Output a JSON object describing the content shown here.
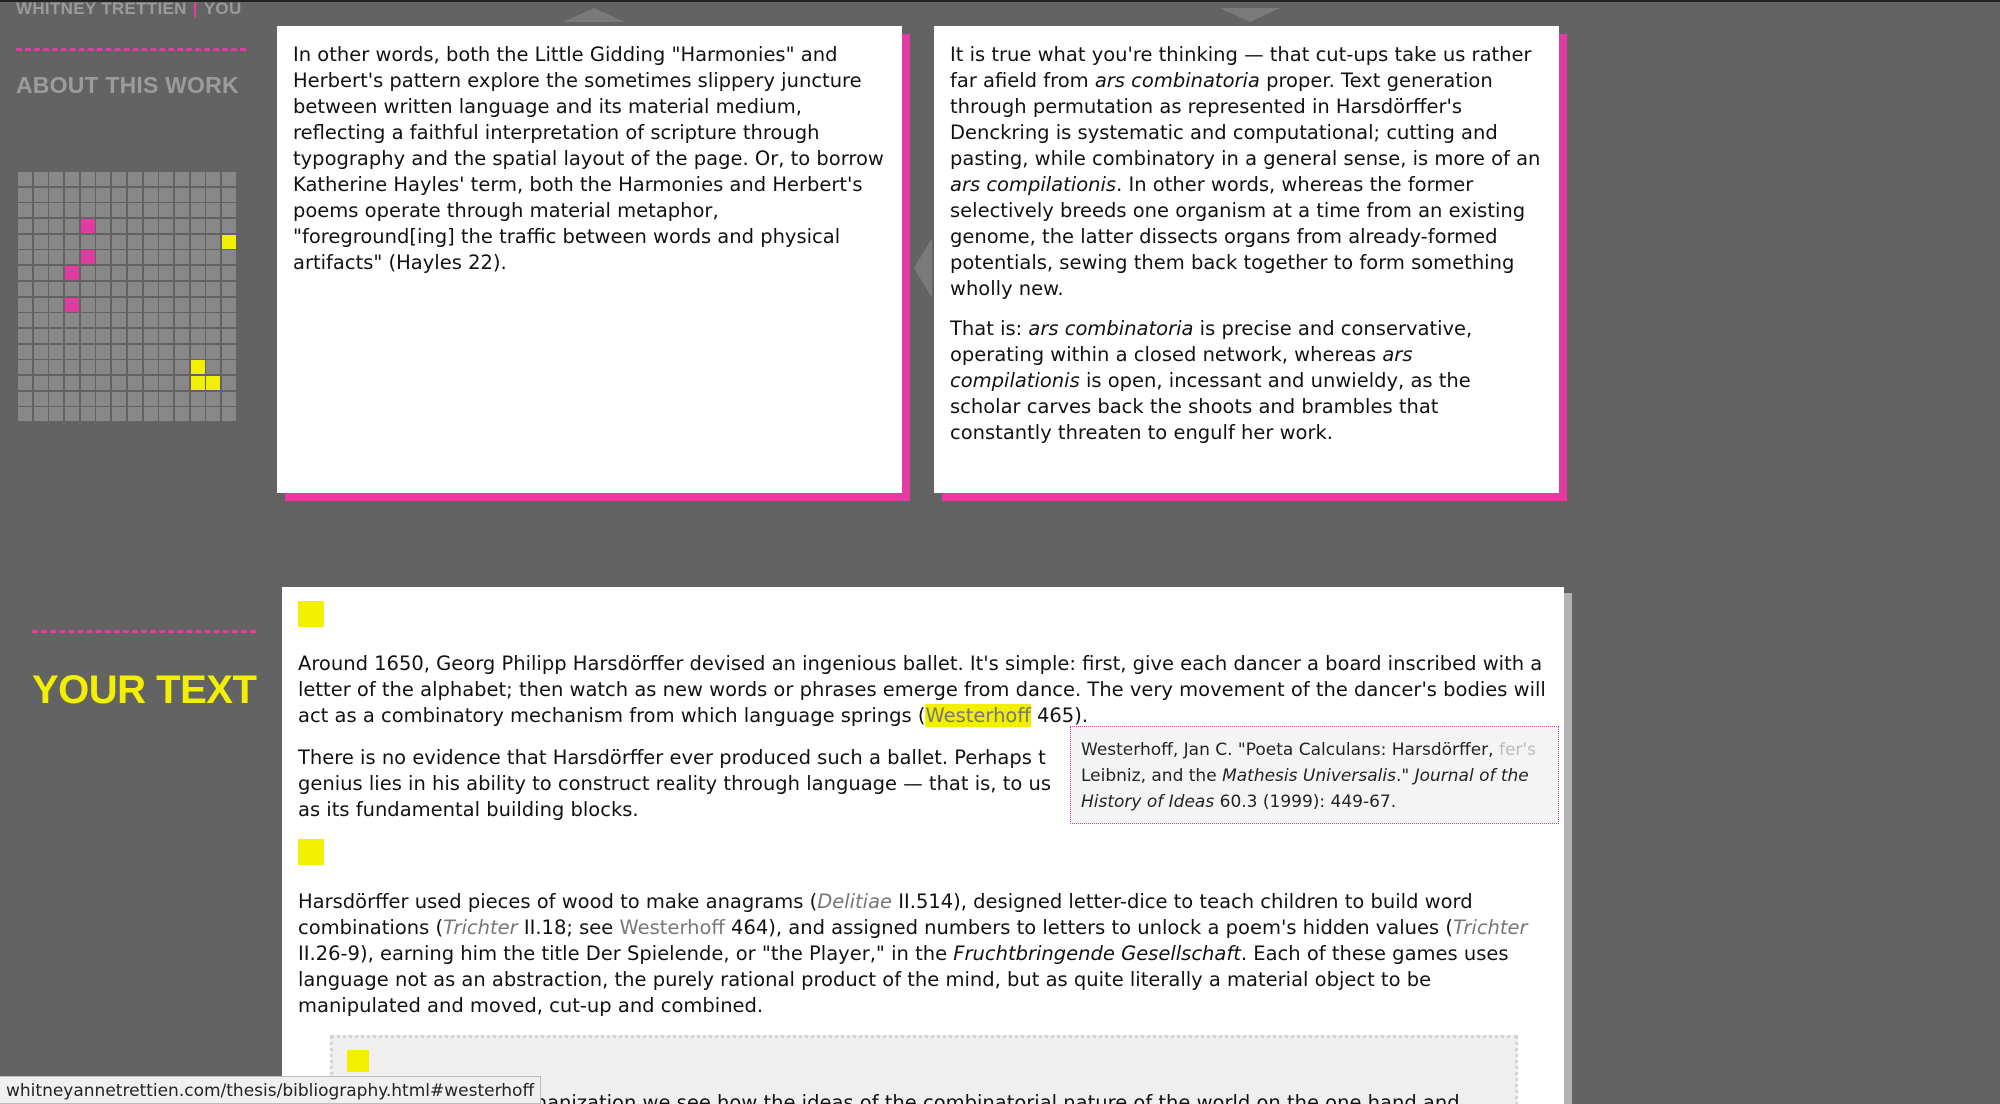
{
  "site_nav": {
    "author": "WHITNEY TRETTIEN",
    "separator": "|",
    "you": "YOU"
  },
  "about": {
    "heading": "ABOUT THIS WORK"
  },
  "grid": {
    "columns": 14,
    "rows": 16,
    "pink_cells": [
      [
        3,
        6
      ],
      [
        3,
        8
      ],
      [
        4,
        3
      ],
      [
        4,
        5
      ]
    ],
    "yellow_cells": [
      [
        11,
        12
      ],
      [
        11,
        13
      ],
      [
        12,
        13
      ],
      [
        13,
        4
      ]
    ]
  },
  "panel_left": {
    "text": "In other words, both the Little Gidding \"Harmonies\" and Herbert's pattern explore the sometimes slippery juncture between written language and its material medium, reflecting a faithful interpretation of scripture through typography and the spatial layout of the page. Or, to borrow Katherine Hayles' term, both the Harmonies and Herbert's poems operate through material metaphor, \"foreground[ing] the traffic between words and physical artifacts\" (Hayles 22)."
  },
  "panel_right": {
    "p1_a": "It is true what you're thinking — that cut-ups take us rather far afield from ",
    "p1_b": "ars combinatoria",
    "p1_c": " proper. Text generation through permutation as represented in Harsdörffer's Denckring is systematic and computational; cutting and pasting, while combinatory in a general sense, is more of an ",
    "p1_d": "ars compilationis",
    "p1_e": ". In other words, whereas the former selectively breeds one organism at a time from an existing genome, the latter dissects organs from already-formed potentials, sewing them back together to form something wholly new.",
    "p2_a": "That is: ",
    "p2_b": "ars combinatoria",
    "p2_c": " is precise and conservative, operating within a closed network, whereas ",
    "p2_d": "ars compilationis",
    "p2_e": " is open, incessant and unwieldy, as the scholar carves back the shoots and brambles that constantly threaten to engulf her work."
  },
  "your_text": {
    "heading": "YOUR TEXT"
  },
  "main": {
    "p1_a": "Around 1650, Georg Philipp Harsdörffer devised an ingenious ballet. It's simple: first, give each dancer a board inscribed with a letter of the alphabet; then watch as new words or phrases emerge from dance. The very movement of the dancer's bodies will act as a combinatory mechanism from which language springs (",
    "p1_ref": "Westerhoff",
    "p1_c": " 465).",
    "p2_a": "There is no evidence that Harsdörffer ever produced such a ballet. Perhaps t",
    "p2_b": "genius lies in his ability to construct reality through language — that is, to us",
    "p2_c": "as its fundamental building blocks.",
    "p3_a": "Harsdörffer used pieces of wood to make anagrams (",
    "p3_ref1": "Delitiae",
    "p3_b": " II.514), designed letter-dice to teach children to build word combinations (",
    "p3_ref2": "Trichter",
    "p3_c": " II.18; see ",
    "p3_ref3": "Westerhoff",
    "p3_d": " 464), and assigned numbers to letters to unlock a poem's hidden values (",
    "p3_ref4": "Trichter",
    "p3_e": " II.26-9), earning him the title Der Spielende, or \"the Player,\" in the ",
    "p3_f": "Fruchtbringende Gesellschaft",
    "p3_g": ". Each of these games uses language not as an abstraction, the purely rational product of the mind, but as quite literally a material object to be manipulated and moved, cut-up and combined.",
    "blockquote_text": "echanization we see how the ideas of the combinatorial nature of the world on the one hand and"
  },
  "tooltip": {
    "a": "Westerhoff, Jan C. \"Poeta Calculans: Harsdörffer,",
    "ghost": " fer's",
    "b": "Leibniz, and the ",
    "c": "Mathesis Universalis",
    "d": ".\" ",
    "e": "Journal of the History of Ideas",
    "f": " 60.3 (1999): 449-67."
  },
  "status_bar": {
    "url": "whitneyannetrettien.com/thesis/bibliography.html#westerhoff"
  },
  "colors": {
    "background": "#636363",
    "accent_pink": "#e23ba2",
    "accent_yellow": "#f2ef00"
  }
}
